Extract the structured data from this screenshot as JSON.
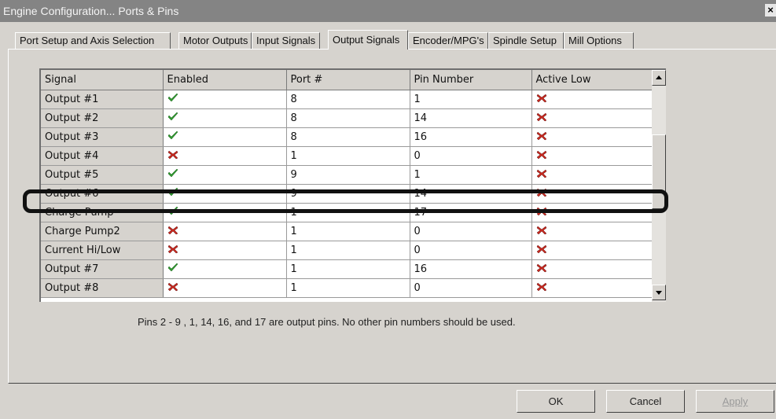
{
  "window": {
    "title": "Engine Configuration... Ports & Pins",
    "close_glyph": "×"
  },
  "tabs": [
    {
      "label": "Port Setup and Axis Selection"
    },
    {
      "label": "Motor Outputs"
    },
    {
      "label": "Input Signals"
    },
    {
      "label": "Output Signals"
    },
    {
      "label": "Encoder/MPG's"
    },
    {
      "label": "Spindle Setup"
    },
    {
      "label": "Mill Options"
    }
  ],
  "active_tab": "Output Signals",
  "grid": {
    "headers": [
      "Signal",
      "Enabled",
      "Port #",
      "Pin Number",
      "Active Low"
    ],
    "rows": [
      {
        "signal": "Output #1",
        "enabled": true,
        "port": "8",
        "pin": "1",
        "active_low": false
      },
      {
        "signal": "Output #2",
        "enabled": true,
        "port": "8",
        "pin": "14",
        "active_low": false
      },
      {
        "signal": "Output #3",
        "enabled": true,
        "port": "8",
        "pin": "16",
        "active_low": false
      },
      {
        "signal": "Output #4",
        "enabled": false,
        "port": "1",
        "pin": "0",
        "active_low": false
      },
      {
        "signal": "Output #5",
        "enabled": true,
        "port": "9",
        "pin": "1",
        "active_low": false
      },
      {
        "signal": "Output #6",
        "enabled": true,
        "port": "9",
        "pin": "14",
        "active_low": false
      },
      {
        "signal": "Charge Pump",
        "enabled": true,
        "port": "1",
        "pin": "17",
        "active_low": false
      },
      {
        "signal": "Charge Pump2",
        "enabled": false,
        "port": "1",
        "pin": "0",
        "active_low": false
      },
      {
        "signal": "Current Hi/Low",
        "enabled": false,
        "port": "1",
        "pin": "0",
        "active_low": false
      },
      {
        "signal": "Output #7",
        "enabled": true,
        "port": "1",
        "pin": "16",
        "active_low": false
      },
      {
        "signal": "Output #8",
        "enabled": false,
        "port": "1",
        "pin": "0",
        "active_low": false
      }
    ],
    "highlighted_signal": "Output #6"
  },
  "note": "Pins 2 - 9 , 1, 14, 16, and 17 are output pins. No  other pin numbers should be used.",
  "buttons": {
    "ok": "OK",
    "cancel": "Cancel",
    "apply": "Apply"
  },
  "colors": {
    "check": "#2e9a2e",
    "cross": "#c8281e"
  },
  "icons": {
    "enabled": "green-check-icon",
    "disabled": "red-x-icon",
    "scroll_up": "arrow-up-icon",
    "scroll_down": "arrow-down-icon"
  }
}
